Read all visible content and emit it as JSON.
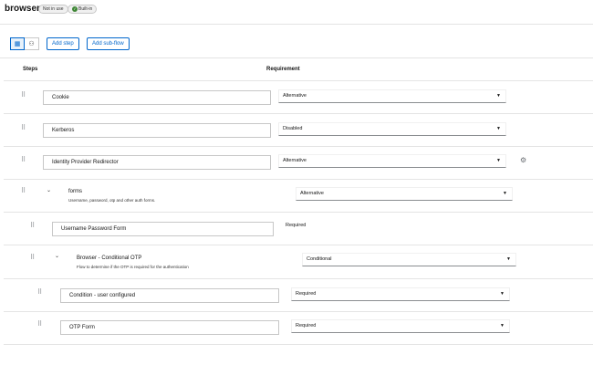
{
  "header": {
    "title": "browser",
    "badge_not_in_use": "Not in use",
    "badge_built_in": "Built-in"
  },
  "toolbar": {
    "table_view_icon": "table-icon",
    "diagram_view_icon": "diagram-icon",
    "add_step": "Add step",
    "add_sub_flow": "Add sub-flow"
  },
  "columns": {
    "steps": "Steps",
    "requirement": "Requirement"
  },
  "rows": [
    {
      "name": "Cookie",
      "requirement": "Alternative",
      "kind": "step"
    },
    {
      "name": "Kerberos",
      "requirement": "Disabled",
      "kind": "step"
    },
    {
      "name": "Identity Provider Redirector",
      "requirement": "Alternative",
      "kind": "step",
      "has_settings": true
    },
    {
      "name": "forms",
      "description": "Username, password, otp and other auth forms.",
      "requirement": "Alternative",
      "kind": "flow"
    },
    {
      "name": "Username Password Form",
      "requirement": "Required",
      "kind": "step-fixed"
    },
    {
      "name": "Browser - Conditional OTP",
      "description": "Flow to determine if the OTP is required for the authentication",
      "requirement": "Conditional",
      "kind": "flow"
    },
    {
      "name": "Condition - user configured",
      "requirement": "Required",
      "kind": "step"
    },
    {
      "name": "OTP Form",
      "requirement": "Required",
      "kind": "step"
    }
  ],
  "icons": {
    "drag": "drag-handle-icon",
    "caret": "caret-down-icon",
    "chevron": "chevron-down-icon",
    "gear": "gear-icon"
  }
}
